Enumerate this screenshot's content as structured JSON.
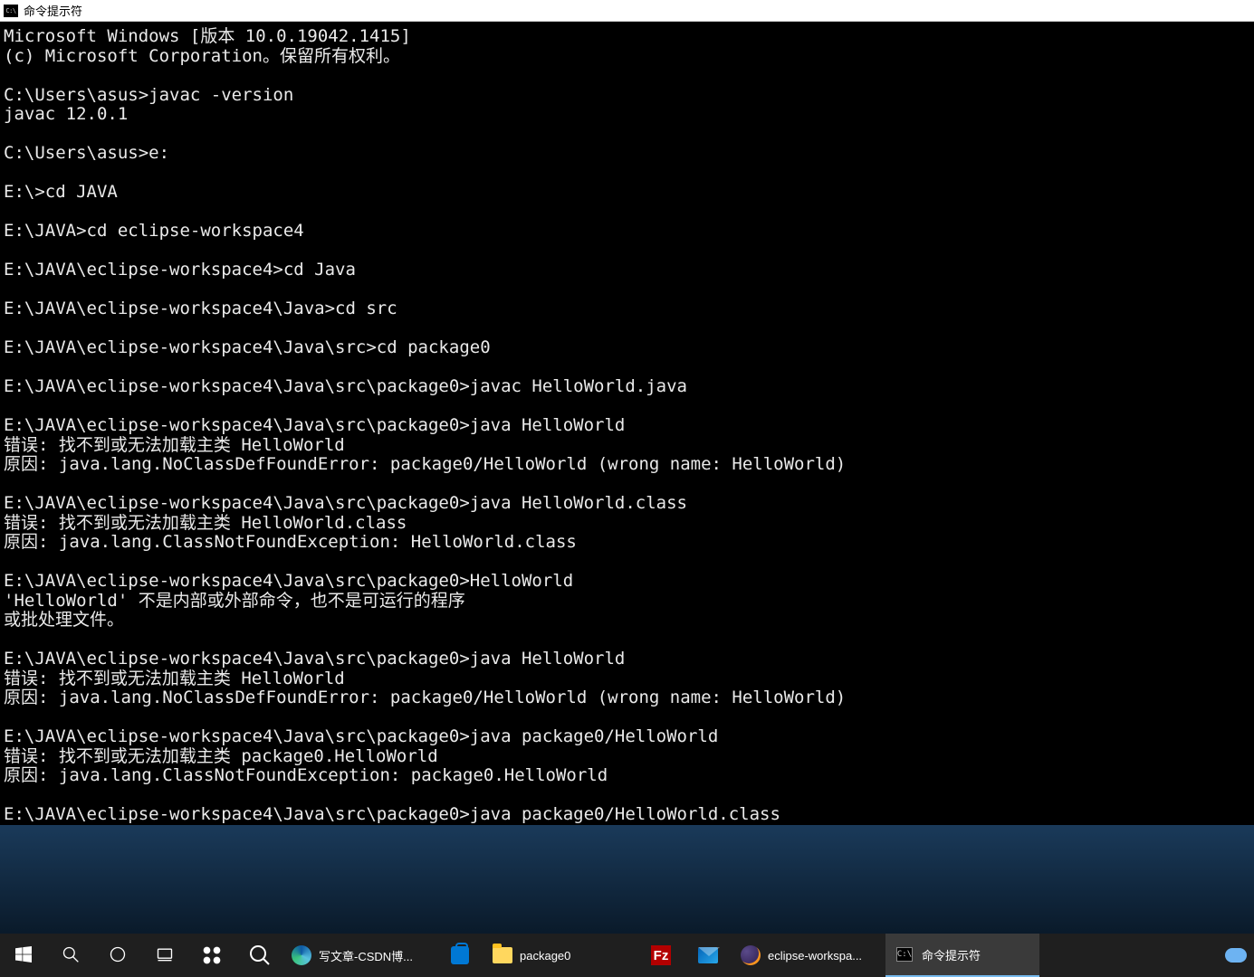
{
  "titlebar": {
    "title": "命令提示符"
  },
  "terminal": {
    "lines": [
      "Microsoft Windows [版本 10.0.19042.1415]",
      "(c) Microsoft Corporation。保留所有权利。",
      "",
      "C:\\Users\\asus>javac -version",
      "javac 12.0.1",
      "",
      "C:\\Users\\asus>e:",
      "",
      "E:\\>cd JAVA",
      "",
      "E:\\JAVA>cd eclipse-workspace4",
      "",
      "E:\\JAVA\\eclipse-workspace4>cd Java",
      "",
      "E:\\JAVA\\eclipse-workspace4\\Java>cd src",
      "",
      "E:\\JAVA\\eclipse-workspace4\\Java\\src>cd package0",
      "",
      "E:\\JAVA\\eclipse-workspace4\\Java\\src\\package0>javac HelloWorld.java",
      "",
      "E:\\JAVA\\eclipse-workspace4\\Java\\src\\package0>java HelloWorld",
      "错误: 找不到或无法加载主类 HelloWorld",
      "原因: java.lang.NoClassDefFoundError: package0/HelloWorld (wrong name: HelloWorld)",
      "",
      "E:\\JAVA\\eclipse-workspace4\\Java\\src\\package0>java HelloWorld.class",
      "错误: 找不到或无法加载主类 HelloWorld.class",
      "原因: java.lang.ClassNotFoundException: HelloWorld.class",
      "",
      "E:\\JAVA\\eclipse-workspace4\\Java\\src\\package0>HelloWorld",
      "'HelloWorld' 不是内部或外部命令，也不是可运行的程序",
      "或批处理文件。",
      "",
      "E:\\JAVA\\eclipse-workspace4\\Java\\src\\package0>java HelloWorld",
      "错误: 找不到或无法加载主类 HelloWorld",
      "原因: java.lang.NoClassDefFoundError: package0/HelloWorld (wrong name: HelloWorld)",
      "",
      "E:\\JAVA\\eclipse-workspace4\\Java\\src\\package0>java package0/HelloWorld",
      "错误: 找不到或无法加载主类 package0.HelloWorld",
      "原因: java.lang.ClassNotFoundException: package0.HelloWorld",
      "",
      "E:\\JAVA\\eclipse-workspace4\\Java\\src\\package0>java package0/HelloWorld.class"
    ]
  },
  "taskbar": {
    "items": [
      {
        "label": "写文章-CSDN博..."
      },
      {
        "label": "package0"
      },
      {
        "label": "eclipse-workspa..."
      },
      {
        "label": "命令提示符"
      }
    ]
  }
}
